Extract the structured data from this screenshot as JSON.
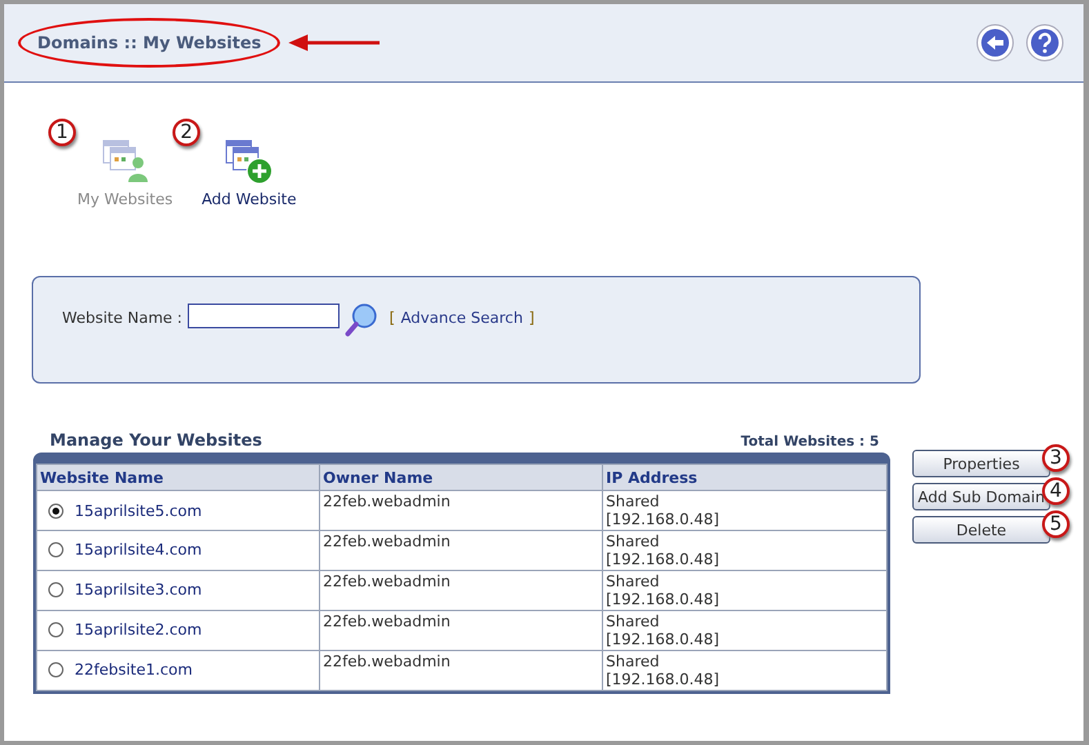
{
  "header": {
    "title": "Domains :: My Websites"
  },
  "tools": [
    {
      "label": "My Websites",
      "disabled": true,
      "callout": "1"
    },
    {
      "label": "Add Website",
      "disabled": false,
      "callout": "2"
    }
  ],
  "search": {
    "label": "Website Name :",
    "link_open": "[",
    "link": "Advance Search",
    "link_close": "]"
  },
  "table": {
    "title": "Manage Your Websites",
    "total": "Total Websites : 5",
    "columns": [
      "Website Name",
      "Owner Name",
      "IP Address"
    ],
    "rows": [
      {
        "selected": true,
        "name": "15aprilsite5.com",
        "owner": "22feb.webadmin",
        "ip_type": "Shared",
        "ip": "[192.168.0.48]"
      },
      {
        "selected": false,
        "name": "15aprilsite4.com",
        "owner": "22feb.webadmin",
        "ip_type": "Shared",
        "ip": "[192.168.0.48]"
      },
      {
        "selected": false,
        "name": "15aprilsite3.com",
        "owner": "22feb.webadmin",
        "ip_type": "Shared",
        "ip": "[192.168.0.48]"
      },
      {
        "selected": false,
        "name": "15aprilsite2.com",
        "owner": "22feb.webadmin",
        "ip_type": "Shared",
        "ip": "[192.168.0.48]"
      },
      {
        "selected": false,
        "name": "22febsite1.com",
        "owner": "22feb.webadmin",
        "ip_type": "Shared",
        "ip": "[192.168.0.48]"
      }
    ]
  },
  "buttons": [
    {
      "label": "Properties",
      "callout": "3"
    },
    {
      "label": "Add Sub Domain",
      "callout": "4"
    },
    {
      "label": "Delete",
      "callout": "5"
    }
  ]
}
